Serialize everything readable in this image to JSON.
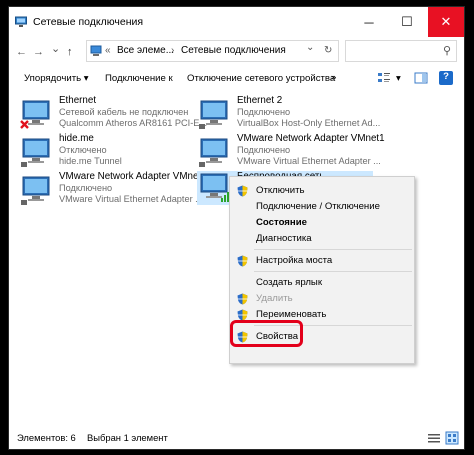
{
  "window": {
    "title": "Сетевые подключения",
    "minimize": "─",
    "maximize": "☐",
    "close": "✕"
  },
  "address": {
    "back": "←",
    "forward": "→",
    "dropdown": "⌄",
    "up": "↑",
    "separator1": "«",
    "crumb1": "Все элеме...",
    "arrow1": "›",
    "crumb2": "Сетевые подключения",
    "dropdown2": "⌄",
    "refresh": "↻",
    "search_placeholder": "",
    "search_icon": "⚲"
  },
  "toolbar": {
    "organize": "Упорядочить",
    "organize_arrow": "▾",
    "connect": "Подключение к",
    "disconnect": "Отключение сетевого устройства",
    "more": "»",
    "view_arrow": "▾",
    "help": "?"
  },
  "connections": [
    {
      "name": "Ethernet",
      "line2": "Сетевой кабель не подключен",
      "line3": "Qualcomm Atheros AR8161 PCI-E...",
      "status": "error"
    },
    {
      "name": "Ethernet 2",
      "line2": "Подключено",
      "line3": "VirtualBox Host-Only Ethernet Ad...",
      "status": "ok"
    },
    {
      "name": "hide.me",
      "line2": "Отключено",
      "line3": "hide.me Tunnel",
      "status": "ok"
    },
    {
      "name": "VMware Network Adapter VMnet1",
      "line2": "Подключено",
      "line3": "VMware Virtual Ethernet Adapter ...",
      "status": "ok"
    },
    {
      "name": "VMware Network Adapter VMnet8",
      "line2": "Подключено",
      "line3": "VMware Virtual Ethernet Adapter ...",
      "status": "ok"
    },
    {
      "name": "Беспроводная сеть",
      "line2": "",
      "line3": "",
      "status": "wireless"
    }
  ],
  "context_menu": {
    "items": [
      {
        "label": "Отключить",
        "shield": true
      },
      {
        "label": "Подключение / Отключение"
      },
      {
        "label": "Состояние",
        "bold": true
      },
      {
        "label": "Диагностика"
      },
      {
        "label": "Настройка моста",
        "shield": true
      },
      {
        "label": "Создать ярлык"
      },
      {
        "label": "Удалить",
        "shield": true,
        "disabled": true
      },
      {
        "label": "Переименовать",
        "shield": true
      },
      {
        "label": "Свойства",
        "shield": true
      }
    ]
  },
  "status": {
    "count": "Элементов: 6",
    "selected": "Выбран 1 элемент"
  },
  "colors": {
    "accent": "#0078d7",
    "selection": "#cce8ff",
    "close_button": "#e81123",
    "highlight_ring": "#e3001b"
  }
}
